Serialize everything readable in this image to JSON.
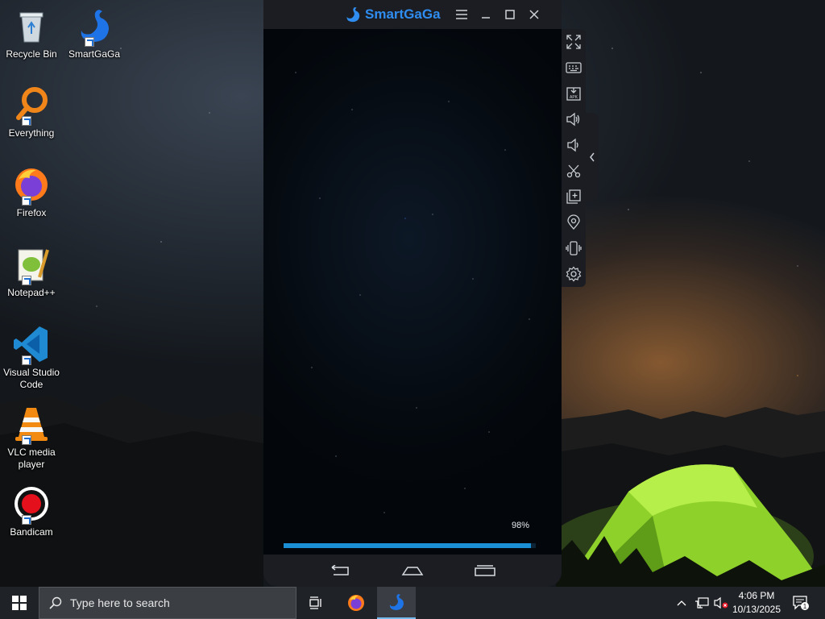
{
  "desktop": {
    "icons": [
      {
        "label": "Recycle Bin",
        "icon": "recycle-bin-icon"
      },
      {
        "label": "SmartGaGa",
        "icon": "smartgaga-icon"
      },
      {
        "label": "Everything",
        "icon": "everything-search-icon"
      },
      {
        "label": "Firefox",
        "icon": "firefox-icon"
      },
      {
        "label": "Notepad++",
        "icon": "notepadpp-icon"
      },
      {
        "label": "Visual Studio Code",
        "icon": "vscode-icon"
      },
      {
        "label": "VLC media player",
        "icon": "vlc-icon"
      },
      {
        "label": "Bandicam",
        "icon": "bandicam-icon"
      }
    ]
  },
  "emulator": {
    "title": "SmartGaGa",
    "accent": "#2f8df0",
    "loading": {
      "percent_text": "98%",
      "progress_fraction": 0.98,
      "bar_color": "#1b8fd6"
    },
    "toolbar": [
      "fullscreen-icon",
      "keyboard-icon",
      "install-apk-icon",
      "volume-up-icon",
      "volume-down-icon",
      "screenshot-scissors-icon",
      "multi-instance-icon",
      "location-icon",
      "shake-icon",
      "settings-icon"
    ],
    "nav": [
      "back-icon",
      "home-icon",
      "recents-icon"
    ]
  },
  "taskbar": {
    "search_placeholder": "Type here to search",
    "pinned": [
      "task-view-icon",
      "firefox-icon",
      "smartgaga-icon"
    ],
    "clock": {
      "time": "4:06 PM",
      "date": "10/13/2025"
    },
    "notification_count": "1"
  }
}
